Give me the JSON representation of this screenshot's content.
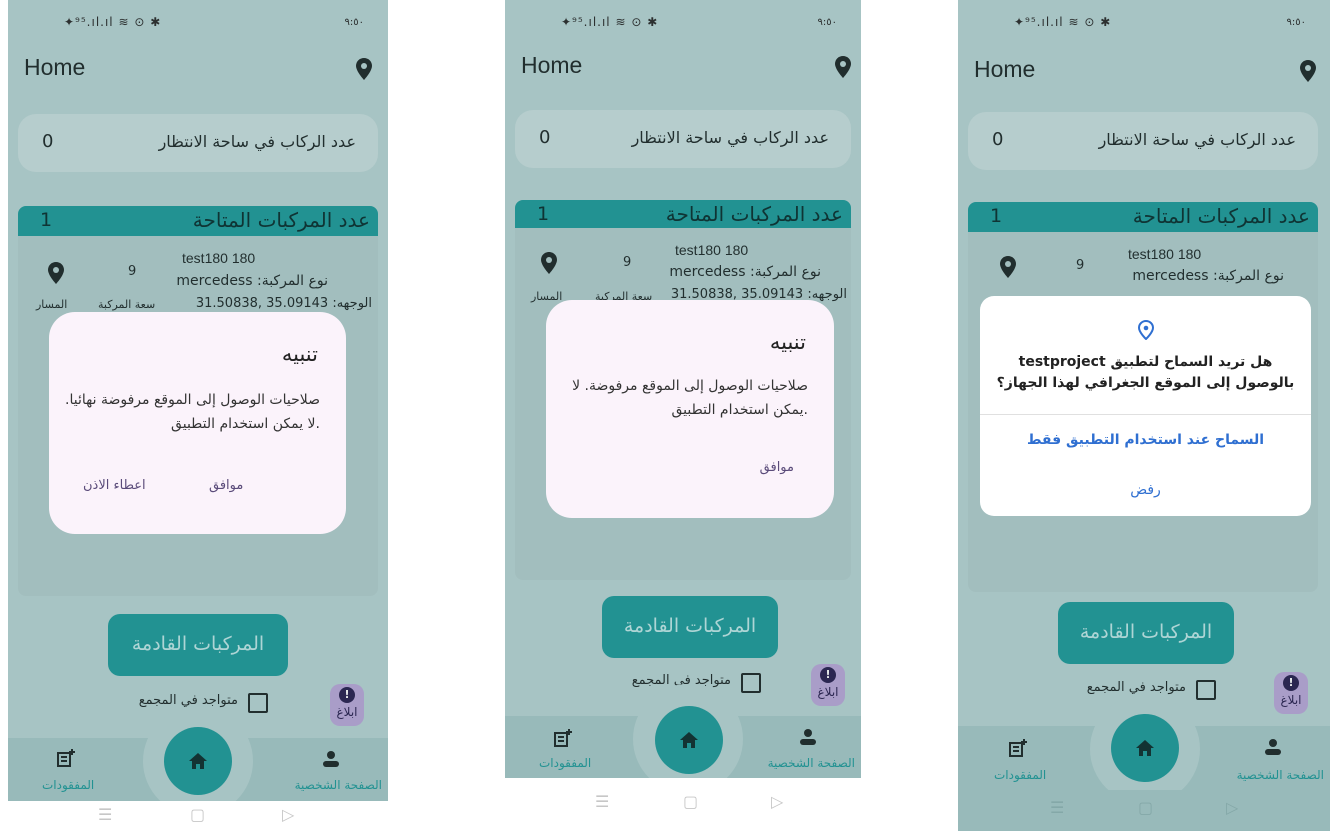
{
  "screens": [
    {
      "status_bar": {
        "icons": "✦⁹⁵.ıl.ıl ≋ ⊙ ✱",
        "time": "٩:٥٠"
      },
      "app_title": "Home",
      "waiting": {
        "count": "0",
        "label": "عدد الركاب في ساحة الانتظار"
      },
      "available": {
        "count": "1",
        "label": "عدد المركبات المتاحة"
      },
      "vehicle": {
        "name": "test180 180",
        "type": "نوع المركبة: mercedess",
        "direction": "الوجهه: 35.09143 ,31.50838",
        "capacity": "9",
        "capacity_label": "سعة المركبة",
        "route_label": "المسار"
      },
      "incoming_button": "المركبات القادمة",
      "checkbox_label": "متواجد في المجمع",
      "report_label": "ابلاغ",
      "nav": {
        "lost": "المفقودات",
        "profile": "الصفحة الشخصية"
      },
      "dialog": {
        "title": "تنبيه",
        "message_line1": "صلاحيات الوصول إلى الموقع مرفوضة نهائيا.",
        "message_line2": ".لا يمكن استخدام التطبيق",
        "ok": "موافق",
        "grant": "اعطاء الاذن"
      }
    },
    {
      "status_bar": {
        "icons": "✦⁹⁵.ıl.ıl ≋ ⊙ ✱",
        "time": "٩:٥٠"
      },
      "app_title": "Home",
      "waiting": {
        "count": "0",
        "label": "عدد الركاب في ساحة الانتظار"
      },
      "available": {
        "count": "1",
        "label": "عدد المركبات المتاحة"
      },
      "vehicle": {
        "name": "test180 180",
        "type": "نوع المركبة: mercedess",
        "direction": "الوجهه: 35.09143 ,31.50838",
        "capacity": "9",
        "capacity_label": "سعة المركبة",
        "route_label": "المسار"
      },
      "incoming_button": "المركبات القادمة",
      "checkbox_label": "متواجد في المجمع",
      "report_label": "ابلاغ",
      "nav": {
        "lost": "المفقودات",
        "profile": "الصفحة الشخصية"
      },
      "dialog": {
        "title": "تنبيه",
        "message_line1": "صلاحيات الوصول إلى الموقع مرفوضة. لا",
        "message_line2": ".يمكن استخدام التطبيق",
        "ok": "موافق"
      }
    },
    {
      "status_bar": {
        "icons": "✦⁹⁵.ıl.ıl ≋ ⊙ ✱",
        "time": "٩:٥٠"
      },
      "app_title": "Home",
      "waiting": {
        "count": "0",
        "label": "عدد الركاب في ساحة الانتظار"
      },
      "available": {
        "count": "1",
        "label": "عدد المركبات المتاحة"
      },
      "vehicle": {
        "name": "test180 180",
        "type": "نوع المركبة: mercedess",
        "capacity": "9"
      },
      "incoming_button": "المركبات القادمة",
      "checkbox_label": "متواجد في المجمع",
      "report_label": "ابلاغ",
      "nav": {
        "lost": "المفقودات",
        "profile": "الصفحة الشخصية"
      },
      "permission": {
        "message_line1": "هل تريد السماح لتطبيق testproject",
        "message_line2": "بالوصول إلى الموقع الجغرافي لهذا الجهاز؟",
        "allow": "السماح عند استخدام التطبيق فقط",
        "deny": "رفض"
      }
    }
  ],
  "colors": {
    "teal": "#1f9a9a",
    "background": "#b7d3d3",
    "dialog": "#fbf3fb",
    "link_blue": "#2f6fd1",
    "report": "#b9a7d8"
  },
  "icons": [
    "location-pin-icon",
    "home-icon",
    "person-icon",
    "lost-items-icon",
    "alert-icon",
    "checkbox-icon",
    "menu-icon",
    "square-icon",
    "back-triangle-icon"
  ]
}
